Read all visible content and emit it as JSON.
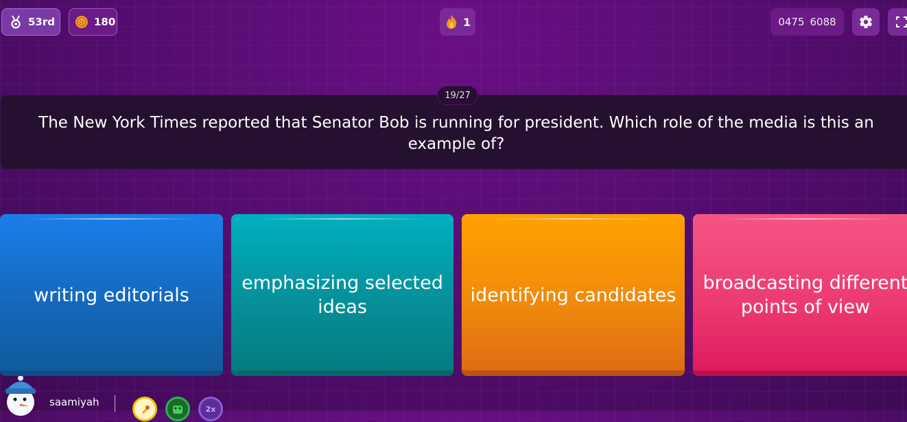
{
  "header": {
    "rank": "53rd",
    "coins": "180",
    "streak": "1",
    "game_code_part1": "0475",
    "game_code_part2": "6088"
  },
  "question": {
    "counter": "19/27",
    "text": "The New York Times reported that Senator Bob is running for president. Which role of the media is this an example of?"
  },
  "options": [
    {
      "label": "writing editorials",
      "color": "#1466b8"
    },
    {
      "label": "emphasizing selected ideas",
      "color": "#068f98"
    },
    {
      "label": "identifying candidates",
      "color": "#f08a0c"
    },
    {
      "label": "broadcasting different points of view",
      "color": "#ec3a72"
    }
  ],
  "player": {
    "username": "saamiyah",
    "powerups": [
      {
        "icon": "rocket-powerup-icon",
        "color": "#f2c200"
      },
      {
        "icon": "monster-powerup-icon",
        "color": "#2bb34a"
      },
      {
        "icon": "2x-multiplier-icon",
        "label": "2x",
        "color": "#8a5bd6"
      }
    ]
  },
  "icons": {
    "rank": "medal-icon",
    "coins": "coin-icon",
    "streak": "flame-icon",
    "settings": "gear-icon",
    "fullscreen": "fullscreen-icon"
  }
}
